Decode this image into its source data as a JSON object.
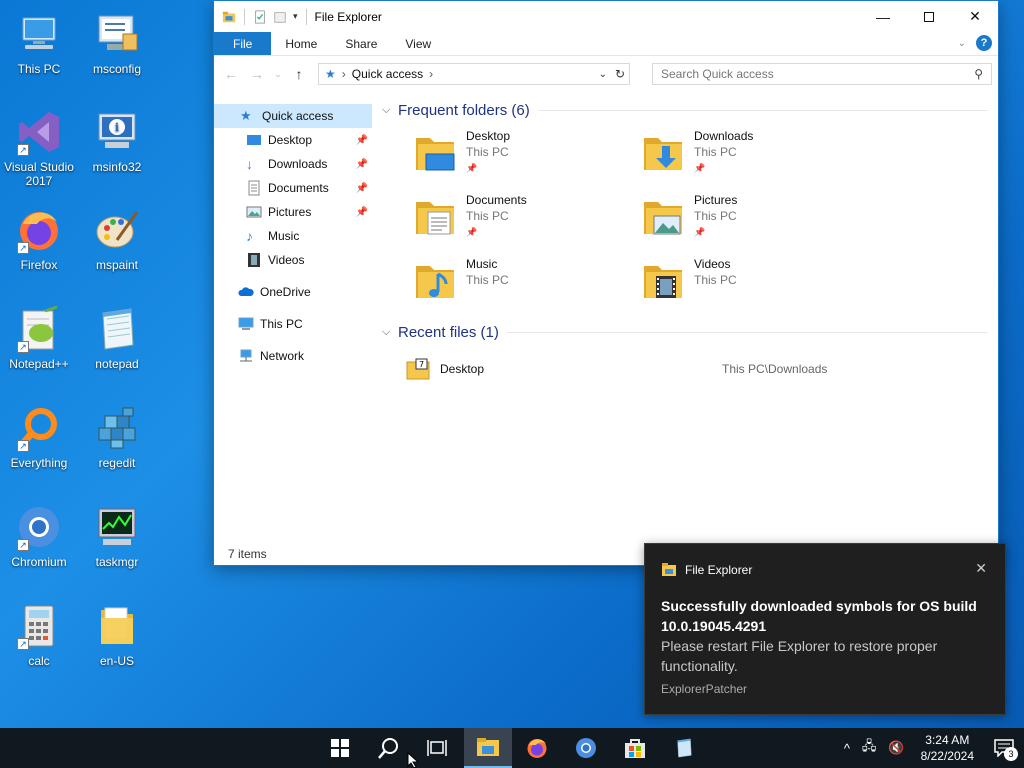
{
  "desktop": {
    "icons": [
      {
        "label": "This PC"
      },
      {
        "label": "msconfig"
      },
      {
        "label": "Visual Studio 2017"
      },
      {
        "label": "msinfo32"
      },
      {
        "label": "Firefox"
      },
      {
        "label": "mspaint"
      },
      {
        "label": "Notepad++"
      },
      {
        "label": "notepad"
      },
      {
        "label": "Everything"
      },
      {
        "label": "regedit"
      },
      {
        "label": "Chromium"
      },
      {
        "label": "taskmgr"
      },
      {
        "label": "calc"
      },
      {
        "label": "en-US"
      }
    ]
  },
  "explorer": {
    "title": "File Explorer",
    "ribbon_tabs": [
      "File",
      "Home",
      "Share",
      "View"
    ],
    "address": "Quick access",
    "search_placeholder": "Search Quick access",
    "nav": {
      "quick_access": "Quick access",
      "items": [
        "Desktop",
        "Downloads",
        "Documents",
        "Pictures",
        "Music",
        "Videos"
      ],
      "onedrive": "OneDrive",
      "this_pc": "This PC",
      "network": "Network"
    },
    "frequent_header": "Frequent folders (6)",
    "frequent": [
      {
        "name": "Desktop",
        "location": "This PC"
      },
      {
        "name": "Downloads",
        "location": "This PC"
      },
      {
        "name": "Documents",
        "location": "This PC"
      },
      {
        "name": "Pictures",
        "location": "This PC"
      },
      {
        "name": "Music",
        "location": "This PC"
      },
      {
        "name": "Videos",
        "location": "This PC"
      }
    ],
    "recent_header": "Recent files (1)",
    "recent": [
      {
        "name": "Desktop",
        "path": "This PC\\Downloads"
      }
    ],
    "status": "7 items"
  },
  "toast": {
    "app": "File Explorer",
    "title": "Successfully downloaded symbols for OS build 10.0.19045.4291",
    "body": "Please restart File Explorer to restore proper functionality.",
    "source": "ExplorerPatcher"
  },
  "taskbar": {
    "time": "3:24 AM",
    "date": "8/22/2024",
    "notification_count": "3"
  },
  "colors": {
    "accent": "#1979ca",
    "folder": "#f5c84c",
    "selection": "#cce8ff"
  }
}
